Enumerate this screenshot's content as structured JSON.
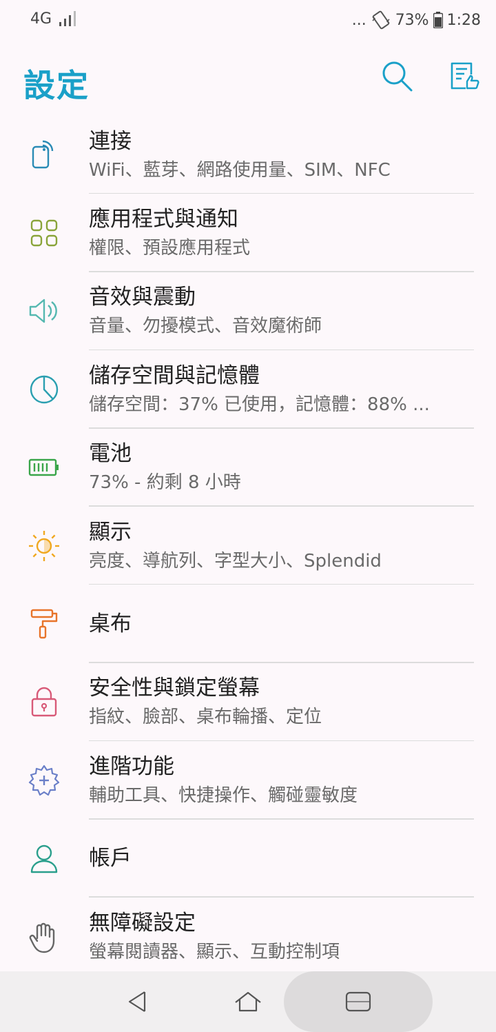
{
  "status_bar": {
    "network": "4G",
    "overflow": "...",
    "battery_percent": "73%",
    "time": "1:28"
  },
  "app_bar": {
    "title": "設定",
    "search_icon": "search-icon",
    "feedback_icon": "document-thumbs-up-icon"
  },
  "colors": {
    "accent": "#1aa0c8",
    "connect": "#2a8bb5",
    "apps": "#8aa43a",
    "sound": "#55b8b0",
    "storage": "#2a9fb0",
    "battery": "#3aa54a",
    "display": "#f0a820",
    "wallpaper": "#e8742a",
    "security": "#d85a78",
    "advanced": "#6a7fc8",
    "accounts": "#2a9f8c",
    "accessibility": "#666666"
  },
  "settings": [
    {
      "title": "連接",
      "subtitle": "WiFi、藍芽、網路使用量、SIM、NFC",
      "icon": "connection-icon"
    },
    {
      "title": "應用程式與通知",
      "subtitle": "權限、預設應用程式",
      "icon": "apps-grid-icon"
    },
    {
      "title": "音效與震動",
      "subtitle": "音量、勿擾模式、音效魔術師",
      "icon": "speaker-icon"
    },
    {
      "title": "儲存空間與記憶體",
      "subtitle": "儲存空間：37% 已使用，記憶體：88% ...",
      "icon": "pie-chart-icon"
    },
    {
      "title": "電池",
      "subtitle": "73% - 約剩 8 小時",
      "icon": "battery-icon"
    },
    {
      "title": "顯示",
      "subtitle": "亮度、導航列、字型大小、Splendid",
      "icon": "brightness-icon"
    },
    {
      "title": "桌布",
      "subtitle": "",
      "icon": "paint-roller-icon"
    },
    {
      "title": "安全性與鎖定螢幕",
      "subtitle": "指紋、臉部、桌布輪播、定位",
      "icon": "lock-icon"
    },
    {
      "title": "進階功能",
      "subtitle": "輔助工具、快捷操作、觸碰靈敏度",
      "icon": "gear-plus-icon"
    },
    {
      "title": "帳戶",
      "subtitle": "",
      "icon": "person-icon"
    },
    {
      "title": "無障礙設定",
      "subtitle": "螢幕閱讀器、顯示、互動控制項",
      "icon": "hand-icon"
    }
  ],
  "nav_bar": {
    "back_icon": "back-icon",
    "home_icon": "home-icon",
    "recents_icon": "recents-icon"
  }
}
